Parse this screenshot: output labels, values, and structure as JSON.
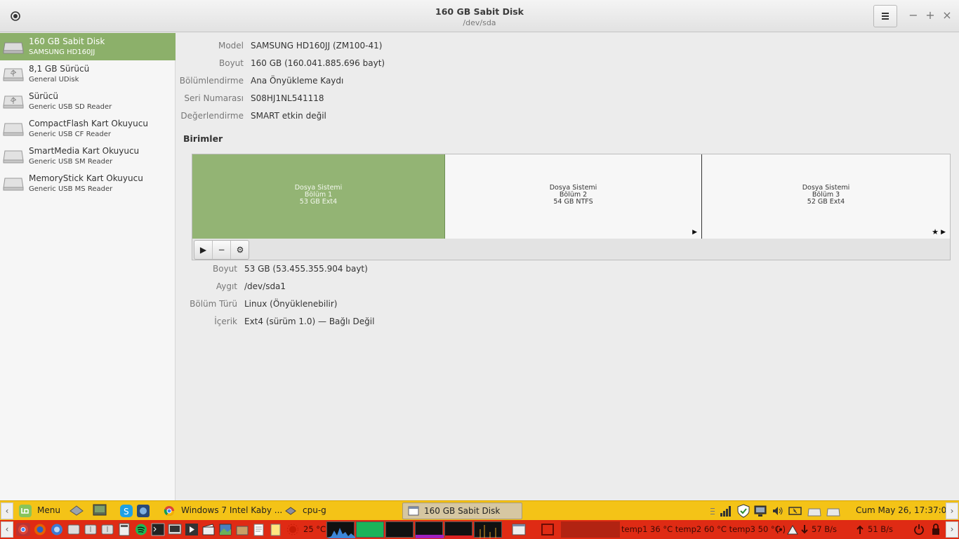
{
  "window": {
    "title": "160 GB Sabit Disk",
    "subtitle": "/dev/sda",
    "menu_icon": "hamburger-icon",
    "minimize": "−",
    "maximize": "+",
    "close": "×"
  },
  "sidebar": {
    "devices": [
      {
        "name": "160 GB Sabit Disk",
        "sub": "SAMSUNG HD160JJ",
        "icon": "hard-disk-icon",
        "selected": true
      },
      {
        "name": "8,1 GB Sürücü",
        "sub": "General UDisk",
        "icon": "usb-drive-icon"
      },
      {
        "name": "Sürücü",
        "sub": "Generic USB SD Reader",
        "icon": "usb-drive-icon"
      },
      {
        "name": "CompactFlash Kart Okuyucu",
        "sub": "Generic USB CF Reader",
        "icon": "card-reader-icon"
      },
      {
        "name": "SmartMedia Kart Okuyucu",
        "sub": "Generic USB SM Reader",
        "icon": "card-reader-icon"
      },
      {
        "name": "MemoryStick Kart Okuyucu",
        "sub": "Generic USB MS Reader",
        "icon": "card-reader-icon"
      }
    ]
  },
  "disk": {
    "model_label": "Model",
    "model": "SAMSUNG HD160JJ (ZM100-41)",
    "size_label": "Boyut",
    "size": "160 GB (160.041.885.696 bayt)",
    "partitioning_label": "Bölümlendirme",
    "partitioning": "Ana Önyükleme Kaydı",
    "serial_label": "Seri Numarası",
    "serial": "S08HJ1NL541118",
    "assessment_label": "Değerlendirme",
    "assessment": "SMART etkin değil"
  },
  "volumes": {
    "title": "Birimler",
    "partitions": [
      {
        "line1": "Dosya Sistemi",
        "line2": "Bölüm 1",
        "line3": "53 GB Ext4",
        "selected": true
      },
      {
        "line1": "Dosya Sistemi",
        "line2": "Bölüm 2",
        "line3": "54 GB NTFS"
      },
      {
        "line1": "Dosya Sistemi",
        "line2": "Bölüm 3",
        "line3": "52 GB Ext4"
      }
    ],
    "tools": {
      "mount": "▶",
      "remove": "−",
      "settings": "⚙"
    }
  },
  "partition": {
    "size_label": "Boyut",
    "size": "53 GB (53.455.355.904 bayt)",
    "device_label": "Aygıt",
    "device": "/dev/sda1",
    "type_label": "Bölüm Türü",
    "type": "Linux (Önyüklenebilir)",
    "contents_label": "İçerik",
    "contents": "Ext4 (sürüm 1.0) — Bağlı Değil"
  },
  "panel_top": {
    "menu": "Menu",
    "task1": "Windows 7 Intel Kaby ...",
    "task2": "cpu-g",
    "task3": "160 GB Sabit Disk",
    "clock": "Cum May 26, 17:37:06",
    "left_arrow": "‹",
    "right_arrow": "›"
  },
  "panel_bottom": {
    "left_arrow": "‹",
    "right_arrow": "›",
    "weather": "25 °C",
    "temps": "temp1 36 °C temp2 60 °C temp3 50 °C",
    "download": "57 B/s",
    "upload": "51 B/s"
  },
  "colors": {
    "accent": "#8cb06a",
    "panel_top": "#f4c317",
    "panel_bottom": "#df2b14"
  }
}
